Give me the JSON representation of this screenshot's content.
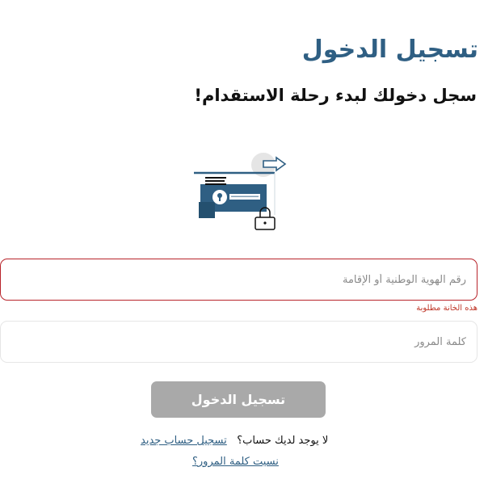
{
  "page": {
    "title": "تسجيل الدخول",
    "subtitle": "سجل دخولك لبدء رحلة الاستقدام!"
  },
  "illustration": {
    "icon": "secure-login-illustration",
    "colors": {
      "primary": "#2f5f83",
      "circle": "#e5e5e5"
    }
  },
  "form": {
    "id_field": {
      "placeholder": "رقم الهوية الوطنية أو الإقامة",
      "value": "",
      "error": "هذه الخانة مطلوبة"
    },
    "password_field": {
      "placeholder": "كلمة المرور",
      "value": ""
    },
    "submit_label": "تسجيل الدخول"
  },
  "links": {
    "no_account_text": "لا يوجد لديك حساب؟",
    "register_label": "تسجيل حساب جديد",
    "forgot_label": "نسيت كلمة المرور؟"
  },
  "colors": {
    "accent": "#2f5f83",
    "error": "#b8242b",
    "button_disabled": "#a9a9a9"
  }
}
